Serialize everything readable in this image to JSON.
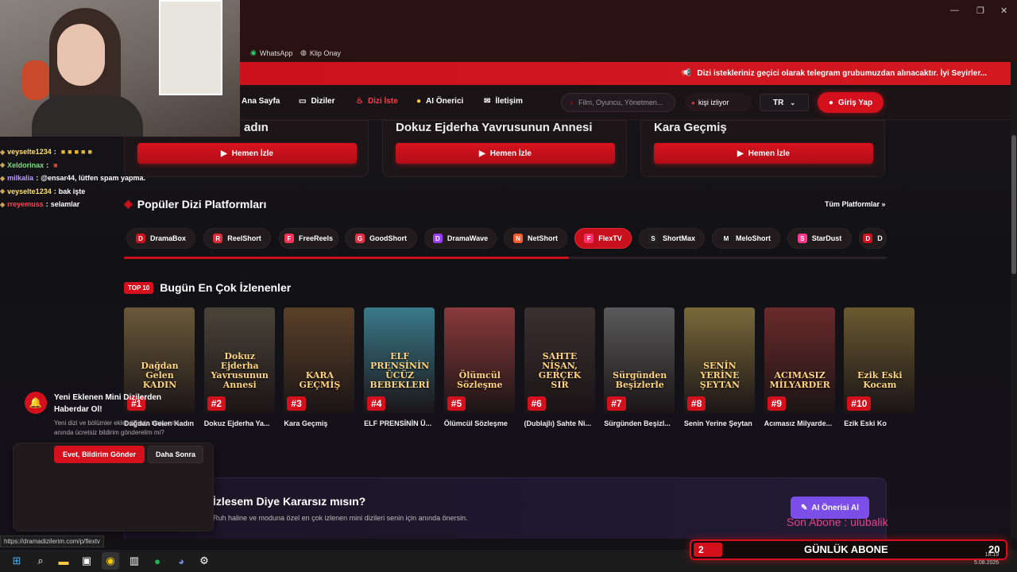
{
  "browser": {
    "bookmarks": [
      {
        "label": "WhatsApp",
        "icon": "whatsapp-icon"
      },
      {
        "label": "Klip Onay",
        "icon": "globe-icon"
      }
    ],
    "status_url": "https://dramadizilerim.com/p/flextv"
  },
  "announcement": "Dizi istekleriniz geçici olarak telegram grubumuzdan alınacaktır. İyi Seyirler...",
  "nav": {
    "items": [
      {
        "label": "Ana Sayfa",
        "icon": "home-icon"
      },
      {
        "label": "Diziler",
        "icon": "tv-icon"
      },
      {
        "label": "Dizi İste",
        "icon": "fire-icon",
        "active": true
      },
      {
        "label": "AI Önerici",
        "icon": "bulb-icon"
      },
      {
        "label": "İletişim",
        "icon": "mail-icon"
      }
    ],
    "search_placeholder": "Film, Oyuncu, Yönetmen...",
    "live_label": "kişi izliyor",
    "lang": "TR",
    "login": "Giriş Yap"
  },
  "hero": [
    {
      "title": "Dağdan Gelen Kadın",
      "button": "Hemen İzle"
    },
    {
      "title": "Dokuz Ejderha Yavrusunun Annesi",
      "button": "Hemen İzle"
    },
    {
      "title": "Kara Geçmiş",
      "button": "Hemen İzle"
    }
  ],
  "platforms": {
    "title": "Popüler Dizi Platformları",
    "all_link": "Tüm Platformlar »",
    "items": [
      {
        "label": "DramaBox",
        "color": "#d4101d"
      },
      {
        "label": "ReelShort",
        "color": "#e02a3a"
      },
      {
        "label": "FreeReels",
        "color": "#ff3355"
      },
      {
        "label": "GoodShort",
        "color": "#e8304a"
      },
      {
        "label": "DramaWave",
        "color": "#9b3dff"
      },
      {
        "label": "NetShort",
        "color": "#ff5a2e"
      },
      {
        "label": "FlexTV",
        "color": "#ff2f6b",
        "active": true
      },
      {
        "label": "ShortMax",
        "color": "#222222"
      },
      {
        "label": "MeloShort",
        "color": "#1a1a1a"
      },
      {
        "label": "StarDust",
        "color": "#ff3a8c"
      },
      {
        "label": "D",
        "color": "#d4101d"
      }
    ]
  },
  "top10": {
    "badge": "TOP 10",
    "title": "Bugün En Çok İzlenenler",
    "items": [
      {
        "rank": "#1",
        "title": "Dağdan Gelen Kadın",
        "poster_text": "Dağdan Gelen KADIN",
        "color": "#6a5a3a"
      },
      {
        "rank": "#2",
        "title": "Dokuz Ejderha Ya...",
        "poster_text": "Dokuz Ejderha Yavrusunun Annesi",
        "color": "#4a4438"
      },
      {
        "rank": "#3",
        "title": "Kara Geçmiş",
        "poster_text": "KARA GEÇMİŞ",
        "color": "#5a4028"
      },
      {
        "rank": "#4",
        "title": "ELF PRENSİNİN Ü...",
        "poster_text": "ELF PRENSİNİN ÜCÜZ BEBEKLERİ",
        "color": "#3a7a8a"
      },
      {
        "rank": "#5",
        "title": "Ölümcül Sözleşme",
        "poster_text": "Ölümcül Sözleşme",
        "color": "#8a3a3a"
      },
      {
        "rank": "#6",
        "title": "(Dublajlı) Sahte Ni...",
        "poster_text": "SAHTE NİŞAN, GERÇEK SIR",
        "color": "#3a3030"
      },
      {
        "rank": "#7",
        "title": "Sürgünden Beşizl...",
        "poster_text": "Sürgünden Beşizlerle",
        "color": "#5a5a5a"
      },
      {
        "rank": "#8",
        "title": "Senin Yerine Şeytan",
        "poster_text": "SENİN YERİNE ŞEYTAN",
        "color": "#7a6a3a"
      },
      {
        "rank": "#9",
        "title": "Acımasız Milyarde...",
        "poster_text": "ACIMASIZ MİLYARDER",
        "color": "#6a2a2a"
      },
      {
        "rank": "#10",
        "title": "Ezik Eski Ko",
        "poster_text": "Ezik Eski Kocam",
        "color": "#6a5a30"
      }
    ]
  },
  "ai_banner": {
    "title": "İzlesem Diye Kararsız mısın?",
    "subtitle": "Ruh haline ve moduna özel en çok izlenen mini dizileri senin için anında önersin.",
    "button": "AI Önerisi Al"
  },
  "notification": {
    "title": "Yeni Eklenen Mini Dizilerden Haberdar Ol!",
    "body": "Yeni dizi ve bölümler eklendiğinde tarayıcına anında ücretsiz bildirim gönderelim mi?",
    "yes": "Evet, Bildirim Gönder",
    "no": "Daha Sonra"
  },
  "chat": [
    {
      "name": "veyselte1234",
      "message": "",
      "name_color": "#ffe066"
    },
    {
      "name": "Xeldorinax",
      "message": "",
      "name_color": "#7ee07e"
    },
    {
      "name": "milkalia",
      "message": "@ensar44, lütfen spam yapma.",
      "name_color": "#b99cff"
    },
    {
      "name": "veyselte1234",
      "message": "bak işte",
      "name_color": "#ffe066"
    },
    {
      "name": "rreyemuss",
      "message": "selamlar",
      "name_color": "#ff4455"
    }
  ],
  "stream_overlay": {
    "last_sub": "Son Abone : ulubalik",
    "sub_count": "2",
    "sub_label": "GÜNLÜK ABONE",
    "sub_goal": "20"
  },
  "clock": {
    "time": "18:19",
    "date": "5.08.2026"
  }
}
